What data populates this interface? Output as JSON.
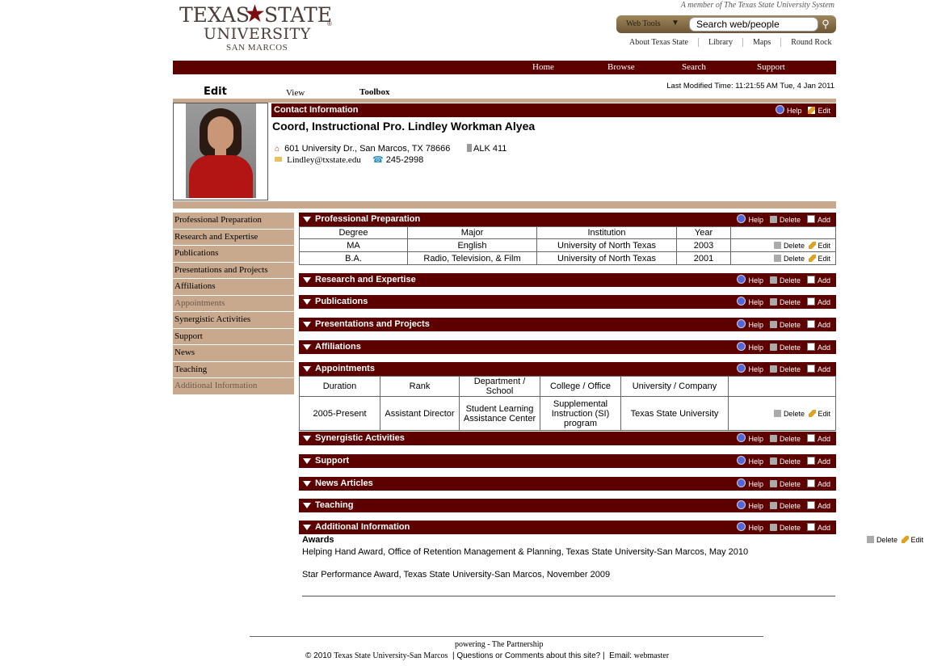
{
  "header": {
    "logo": {
      "line1": "TEXAS",
      "star": "★",
      "line1b": "STATE",
      "line2": "UNIVERSITY",
      "line3": "SAN MARCOS",
      "reg": "®"
    },
    "member_text": "A member of The Texas State University System",
    "search": {
      "scope_label": "Web Tools",
      "placeholder": "Search web/people",
      "value": "Search web/people"
    },
    "top_links": [
      "About Texas State",
      "Library",
      "Maps",
      "Round Rock"
    ],
    "nav": [
      "Home",
      "Browse",
      "Search",
      "Support"
    ]
  },
  "tabs": {
    "edit": "Edit",
    "view": "View",
    "toolbox": "Toolbox"
  },
  "last_modified": "Last Modified Time: 11:21:55 AM Tue, 4 Jan 2011",
  "contact": {
    "title": "Contact Information",
    "help": "Help",
    "edit": "Edit",
    "name": "Coord, Instructional Pro. Lindley Workman Alyea",
    "address": "601 University Dr., San Marcos, TX 78666",
    "office": "ALK 411",
    "email": "Lindley@txstate.edu",
    "phone": "245-2998"
  },
  "sidebar": [
    "Professional Preparation",
    "Research and Expertise",
    "Publications",
    "Presentations and Projects",
    "Affiliations",
    "Appointments",
    "Synergistic Activities",
    "Support",
    "News",
    "Teaching",
    "Additional Information"
  ],
  "labels": {
    "help": "Help",
    "delete": "Delete",
    "add": "Add",
    "edit": "Edit"
  },
  "sections": {
    "prof_prep": "Professional Preparation",
    "research": "Research and Expertise",
    "publications": "Publications",
    "presentations": "Presentations and Projects",
    "affiliations": "Affiliations",
    "appointments": "Appointments",
    "synergistic": "Synergistic Activities",
    "support": "Support",
    "news": "News Articles",
    "teaching": "Teaching",
    "additional": "Additional Information"
  },
  "prof_prep_table": {
    "headers": [
      "Degree",
      "Major",
      "Institution",
      "Year"
    ],
    "rows": [
      [
        "MA",
        "English",
        "University of North Texas",
        "2003"
      ],
      [
        "B.A.",
        "Radio, Television, & Film",
        "University of North Texas",
        "2001"
      ]
    ]
  },
  "appointments_table": {
    "headers": [
      "Duration",
      "Rank",
      "Department / School",
      "College / Office",
      "University / Company"
    ],
    "rows": [
      [
        "2005-Present",
        "Assistant Director",
        "Student Learning Assistance Center",
        "Supplemental Instruction (SI) program",
        "Texas State University"
      ]
    ]
  },
  "additional": {
    "heading": "Awards",
    "items": [
      "Helping Hand Award, Office of Retention Management & Planning, Texas State University-San Marcos, May 2010",
      "Star Performance Award, Texas State University-San Marcos, November 2009"
    ]
  },
  "footer": {
    "powering": "powering - The Partnership",
    "copyright": "© 2010",
    "university": "Texas State University-San Marcos",
    "questions": "| Questions or Comments about this site? |",
    "email_label": "Email:",
    "email_link": "webmaster"
  }
}
